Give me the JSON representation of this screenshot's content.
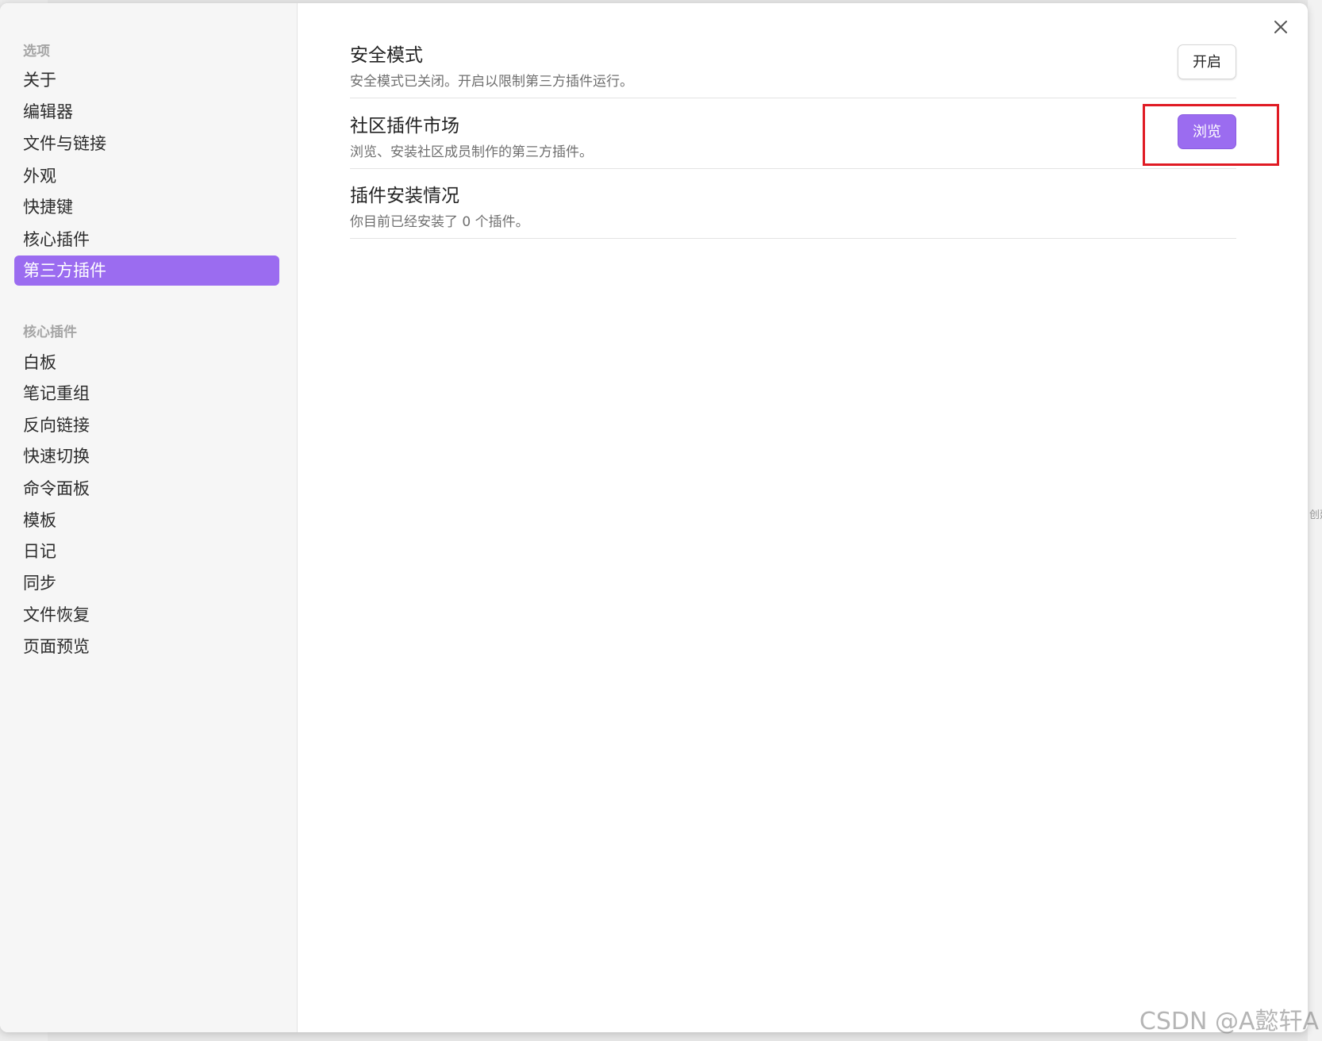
{
  "sidebar": {
    "options_header": "选项",
    "options": [
      {
        "label": "关于"
      },
      {
        "label": "编辑器"
      },
      {
        "label": "文件与链接"
      },
      {
        "label": "外观"
      },
      {
        "label": "快捷键"
      },
      {
        "label": "核心插件"
      },
      {
        "label": "第三方插件",
        "active": true
      }
    ],
    "core_header": "核心插件",
    "core_plugins": [
      {
        "label": "白板"
      },
      {
        "label": "笔记重组"
      },
      {
        "label": "反向链接"
      },
      {
        "label": "快速切换"
      },
      {
        "label": "命令面板"
      },
      {
        "label": "模板"
      },
      {
        "label": "日记"
      },
      {
        "label": "同步"
      },
      {
        "label": "文件恢复"
      },
      {
        "label": "页面预览"
      }
    ]
  },
  "settings": [
    {
      "name": "安全模式",
      "desc": "安全模式已关闭。开启以限制第三方插件运行。",
      "button": "开启"
    },
    {
      "name": "社区插件市场",
      "desc": "浏览、安装社区成员制作的第三方插件。",
      "button": "浏览"
    },
    {
      "name": "插件安装情况",
      "desc": "你目前已经安装了 0 个插件。"
    }
  ],
  "background_text": "创建",
  "watermark": "CSDN @A懿轩A",
  "icons": {
    "close": "close-icon"
  },
  "colors": {
    "accent": "#9b6cf0",
    "highlight": "#e01b24"
  }
}
